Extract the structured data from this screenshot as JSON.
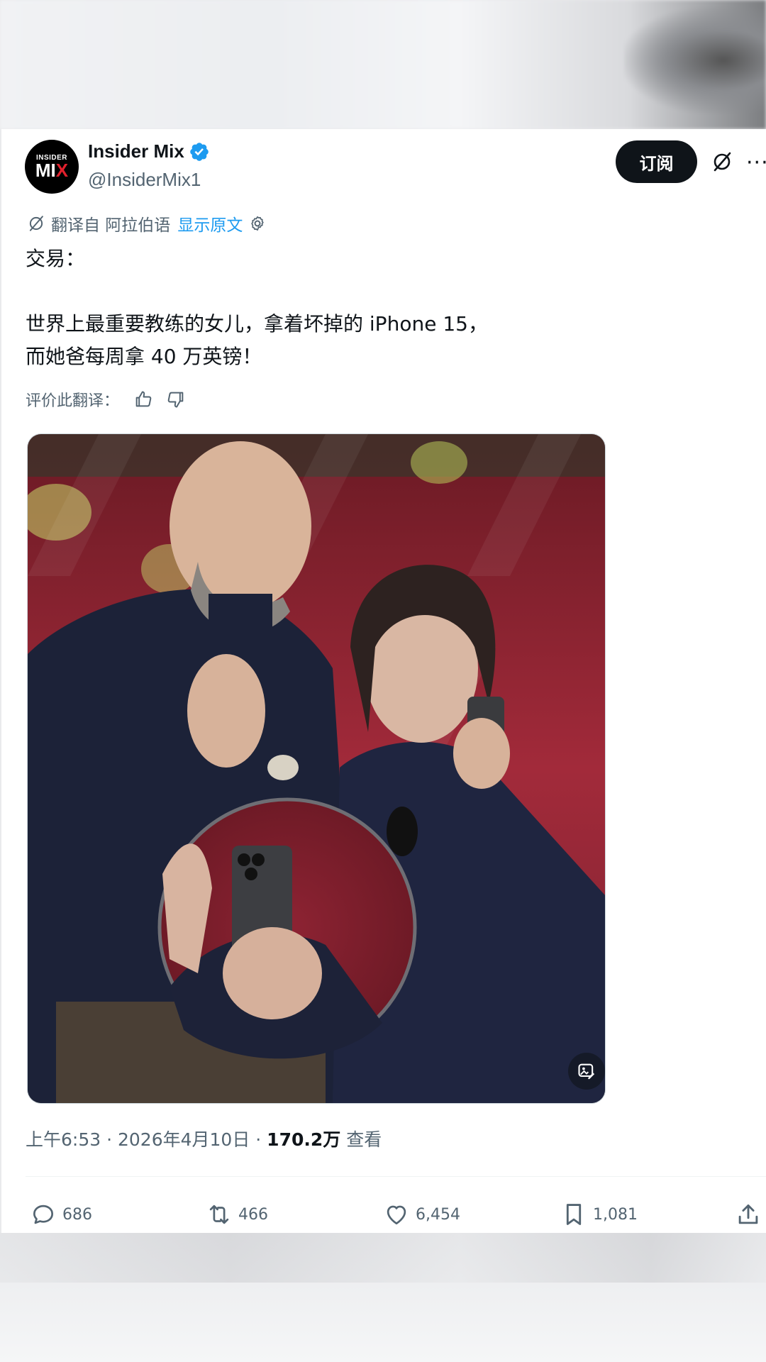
{
  "author": {
    "name": "Insider Mix",
    "handle": "@InsiderMix1",
    "avatar_line1": "INSIDER",
    "avatar_line2a": "MI",
    "avatar_line2b": "X",
    "verified": true
  },
  "header": {
    "subscribe_label": "订阅",
    "grok_icon": "grok-icon",
    "more_icon": "more-icon"
  },
  "translation": {
    "translated_from": "翻译自 阿拉伯语",
    "show_original": "显示原文",
    "rate_label": "评价此翻译："
  },
  "tweet": {
    "text": "交易：\n\n世界上最重要教练的女儿，拿着坏掉的 iPhone 15，\n而她爸每周拿 40 万英镑！"
  },
  "meta": {
    "time_date": "上午6:53 · 2026年4月10日 · ",
    "views_count": "170.2万",
    "views_label": " 查看"
  },
  "actions": {
    "replies": "686",
    "reposts": "466",
    "likes": "6,454",
    "bookmarks": "1,081"
  },
  "colors": {
    "accent": "#1d9bf0",
    "text": "#0f1419",
    "secondary": "#536471",
    "button_bg": "#0f1419"
  }
}
